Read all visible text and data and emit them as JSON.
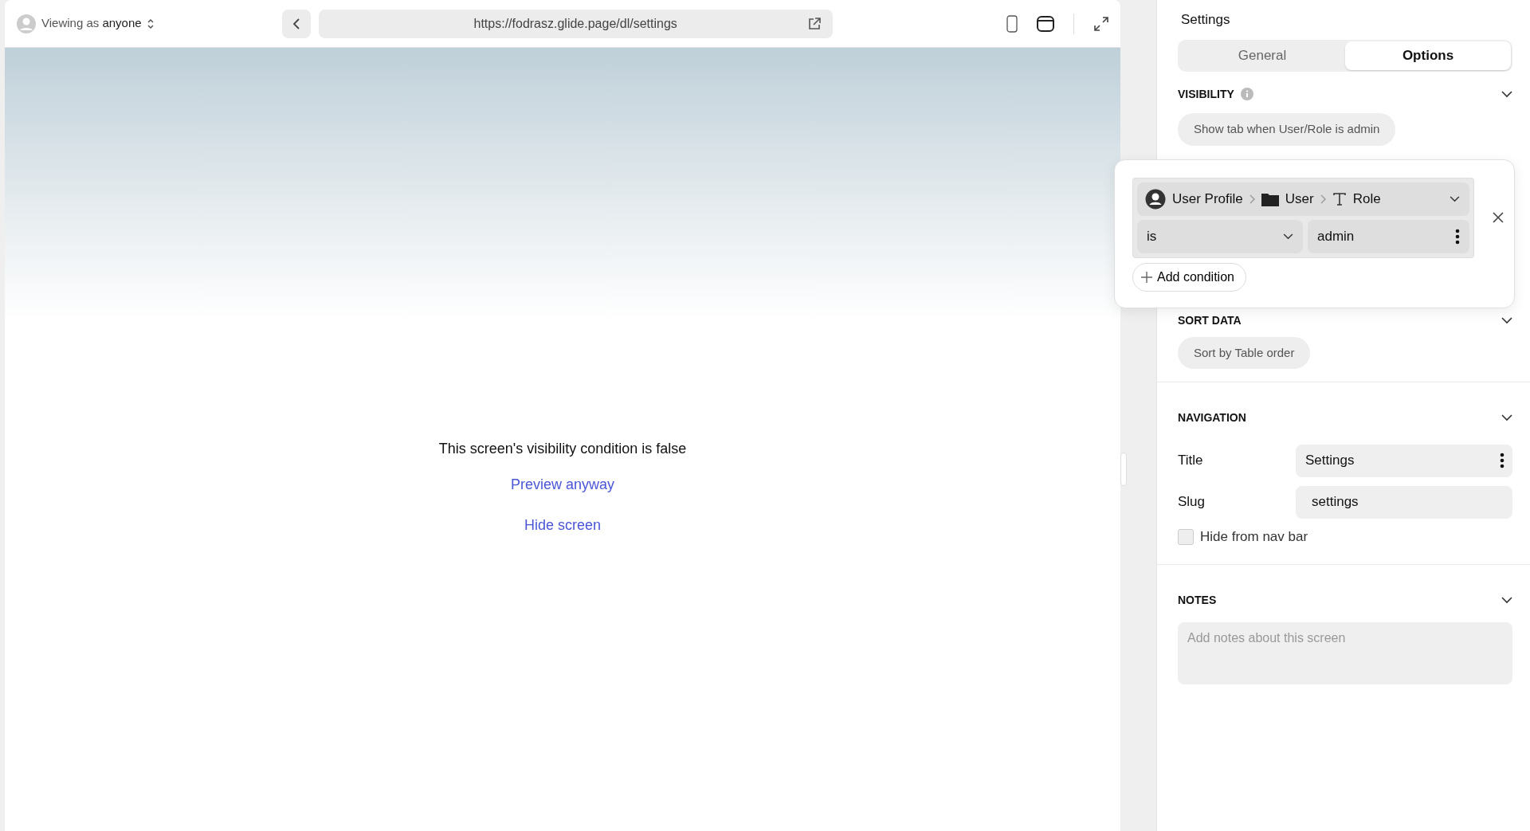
{
  "preview": {
    "viewer_prefix": "Viewing as",
    "viewer_name": "anyone",
    "url": "https://fodrasz.glide.page/dl/settings",
    "message": "This screen's visibility condition is false",
    "links": [
      "Preview anyway",
      "Hide screen"
    ]
  },
  "panel": {
    "title": "Settings",
    "tabs": [
      {
        "label": "General",
        "selected": false
      },
      {
        "label": "Options",
        "selected": true
      }
    ],
    "visibility": {
      "title": "VISIBILITY",
      "chip": "Show tab when User/Role is admin"
    },
    "sort_data": {
      "title": "SORT DATA",
      "chip": "Sort by Table order"
    },
    "navigation": {
      "title": "NAVIGATION",
      "fields": [
        {
          "label": "Title",
          "value": "Settings",
          "has_menu": true
        },
        {
          "label": "Slug",
          "value": "settings",
          "has_menu": false
        }
      ],
      "checkbox": {
        "label": "Hide from nav bar",
        "checked": false
      }
    },
    "notes": {
      "title": "NOTES",
      "placeholder": "Add notes about this screen"
    }
  },
  "condition_popover": {
    "path": [
      {
        "kind": "person",
        "label": "User Profile"
      },
      {
        "kind": "folder",
        "label": "User"
      },
      {
        "kind": "text",
        "label": "Role"
      }
    ],
    "operator": "is",
    "value": "admin",
    "add_label": "Add condition"
  }
}
